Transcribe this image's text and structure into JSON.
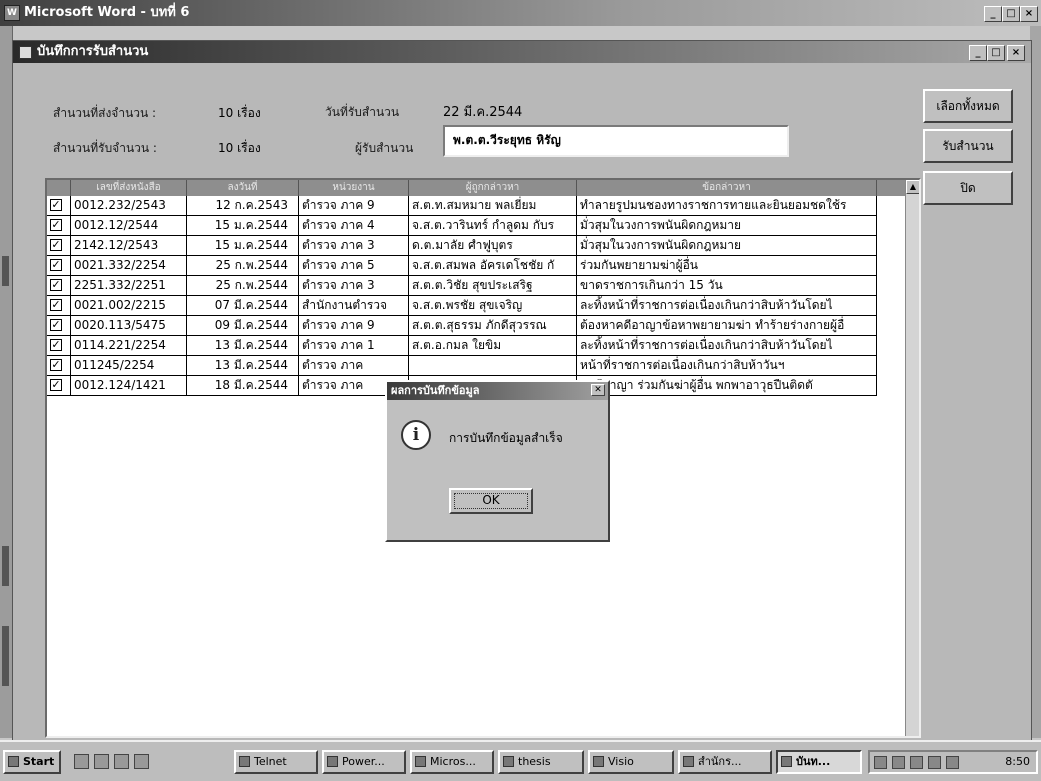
{
  "word_window": {
    "title": "Microsoft Word - บทที่ 6",
    "buttons": [
      "_",
      "□",
      "×"
    ]
  },
  "dialog": {
    "title": "บันทึกการรับสำนวน",
    "buttons": [
      "_",
      "□",
      "×"
    ],
    "fields": {
      "sent_label": "สำนวนที่ส่งจำนวน :",
      "sent_value": "10 เรื่อง",
      "received_label": "สำนวนที่รับจำนวน :",
      "received_value": "10 เรื่อง",
      "date_label": "วันที่รับสำนวน",
      "date_value": "22 มี.ค.2544",
      "receiver_label": "ผู้รับสำนวน",
      "receiver_value": "พ.ต.ต.วีระยุทธ หิรัญ"
    },
    "side_buttons": {
      "select_all": "เลือกทั้งหมด",
      "receive": "รับสำนวน",
      "close": "ปิด"
    }
  },
  "grid": {
    "columns": [
      "เลขที่ส่งหนังสือ",
      "ลงวันที่",
      "หน่วยงาน",
      "ผู้ถูกกล่าวหา",
      "ข้อกล่าวหา"
    ],
    "rows": [
      {
        "checked": true,
        "doc": "0012.232/2543",
        "date": "12 ก.ค.2543",
        "unit": "ตำรวจ ภาค 9",
        "accused": "ส.ต.ท.สมหมาย พลเยี่ยม",
        "charge": "ทำลายรูปมนชองทางราชการทายและยินยอมชดใช้ร"
      },
      {
        "checked": true,
        "doc": "0012.12/2544",
        "date": "15 ม.ค.2544",
        "unit": "ตำรวจ ภาค 4",
        "accused": "จ.ส.ต.วารินทร์ กำลูดม กับร",
        "charge": "มั่วสุมในวงการพนันผิดกฎหมาย"
      },
      {
        "checked": true,
        "doc": "2142.12/2543",
        "date": "15 ม.ค.2544",
        "unit": "ตำรวจ ภาค 3",
        "accused": "ด.ต.มาลัย ศำฟูบุตร",
        "charge": "มั่วสุมในวงการพนันผิดกฎหมาย"
      },
      {
        "checked": true,
        "doc": "0021.332/2254",
        "date": "25 ก.พ.2544",
        "unit": "ตำรวจ ภาค 5",
        "accused": "จ.ส.ต.สมพล อัครเดโชชัย กั",
        "charge": "ร่วมกันพยายามฆ่าผู้อื่น"
      },
      {
        "checked": true,
        "doc": "2251.332/2251",
        "date": "25 ก.พ.2544",
        "unit": "ตำรวจ ภาค 3",
        "accused": "ส.ต.ต.วิชัย สุขประเสริฐ",
        "charge": "ขาดราชการเกินกว่า 15 วัน"
      },
      {
        "checked": true,
        "doc": "0021.002/2215",
        "date": "07 มี.ค.2544",
        "unit": "สำนักงานตำรวจ",
        "accused": "จ.ส.ต.พรชัย สุขเจริญ",
        "charge": "ละทิ้งหน้าที่ราชการต่อเนื่องเกินกว่าสิบห้าวันโดยไ"
      },
      {
        "checked": true,
        "doc": "0020.113/5475",
        "date": "09 มี.ค.2544",
        "unit": "ตำรวจ ภาค 9",
        "accused": "ส.ต.ต.สุธรรม ภักดีสุวรรณ",
        "charge": "ต้องหาคดีอาญาข้อหาพยายามฆ่า ทำร้ายร่างกายผู้อื่"
      },
      {
        "checked": true,
        "doc": "0114.221/2254",
        "date": "13 มี.ค.2544",
        "unit": "ตำรวจ ภาค 1",
        "accused": "ส.ต.อ.กมล ใยขิม",
        "charge": "ละทิ้งหน้าที่ราชการต่อเนื่องเกินกว่าสิบห้าวันโดยไ"
      },
      {
        "checked": true,
        "doc": "011245/2254",
        "date": "13 มี.ค.2544",
        "unit": "ตำรวจ ภาค",
        "accused": "",
        "charge": "หน้าที่ราชการต่อเนื่องเกินกว่าสิบห้าวันฯ"
      },
      {
        "checked": true,
        "doc": "0012.124/1421",
        "date": "18 มี.ค.2544",
        "unit": "ตำรวจ ภาค",
        "accused": "",
        "charge": "าคดีอาญา ร่วมกันฆ่าผู้อื่น พกพาอาวุธปืนติดตั"
      }
    ]
  },
  "message_box": {
    "title": "ผลการบันทึกข้อมูล",
    "text": "การบันทึกข้อมูลสำเร็จ",
    "ok": "OK",
    "icon": "info-icon"
  },
  "taskbar": {
    "start": "Start",
    "items": [
      "Telnet",
      "Power...",
      "Micros...",
      "thesis",
      "Visio",
      "สำนักร...",
      "บันท..."
    ],
    "active_index": 6,
    "clock": "8:50"
  }
}
